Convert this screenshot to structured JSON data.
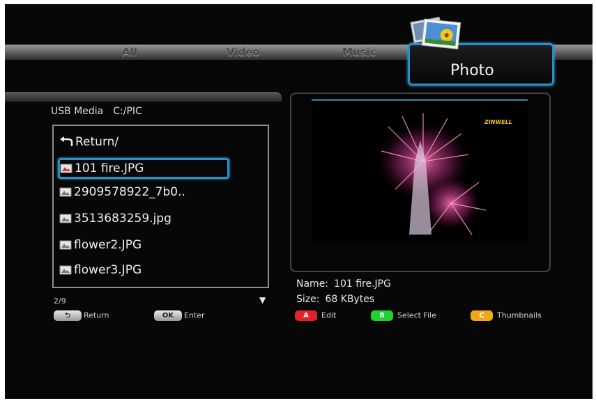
{
  "tabs": {
    "all": "All",
    "video": "Video",
    "music": "Music",
    "photo": "Photo"
  },
  "location": {
    "device": "USB Media",
    "path": "C:/PIC"
  },
  "files": {
    "items": [
      {
        "label": "Return/",
        "icon": "return-arrow-icon"
      },
      {
        "label": "101 fire.JPG",
        "icon": "photo-file-icon",
        "selected": true
      },
      {
        "label": "2909578922_7b0..",
        "icon": "photo-file-icon"
      },
      {
        "label": "3513683259.jpg",
        "icon": "photo-file-icon"
      },
      {
        "label": "flower2.JPG",
        "icon": "photo-file-icon"
      },
      {
        "label": "flower3.JPG",
        "icon": "photo-file-icon"
      }
    ],
    "page": "2/9"
  },
  "hints": {
    "return": "Return",
    "ok_key": "OK",
    "ok": "Enter"
  },
  "preview": {
    "watermark": "ZINWELL"
  },
  "details": {
    "name_label": "Name:",
    "name_value": "101 fire.JPG",
    "size_label": "Size:",
    "size_value": "68 KBytes"
  },
  "color_buttons": [
    {
      "key": "A",
      "label": "Edit",
      "color": "#e0222b"
    },
    {
      "key": "B",
      "label": "Select File",
      "color": "#1fd02e"
    },
    {
      "key": "C",
      "label": "Thumbnails",
      "color": "#f0a818"
    }
  ]
}
